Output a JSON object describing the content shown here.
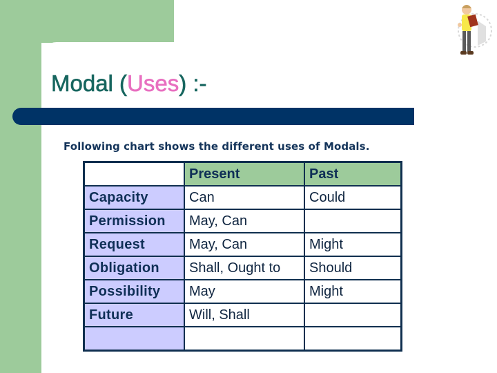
{
  "slide": {
    "title_prefix": "Modal (",
    "title_accent": "Uses",
    "title_suffix": ") :-",
    "subtitle": "Following chart shows the different uses of Modals.",
    "colors": {
      "title": "#17665f",
      "accent": "#e86fc0",
      "bar": "#003366",
      "green": "#9dcb9b",
      "lavender": "#ccccff"
    },
    "mascot_icon": "man-reading-book-icon"
  },
  "table": {
    "headers": [
      "",
      "Present",
      "Past"
    ],
    "rows": [
      [
        "Capacity",
        "Can",
        "Could"
      ],
      [
        "Permission",
        "May, Can",
        ""
      ],
      [
        "Request",
        "May, Can",
        "Might"
      ],
      [
        "Obligation",
        "Shall, Ought to",
        "Should"
      ],
      [
        "Possibility",
        "May",
        "Might"
      ],
      [
        "Future",
        "Will, Shall",
        ""
      ],
      [
        "",
        "",
        ""
      ]
    ]
  }
}
